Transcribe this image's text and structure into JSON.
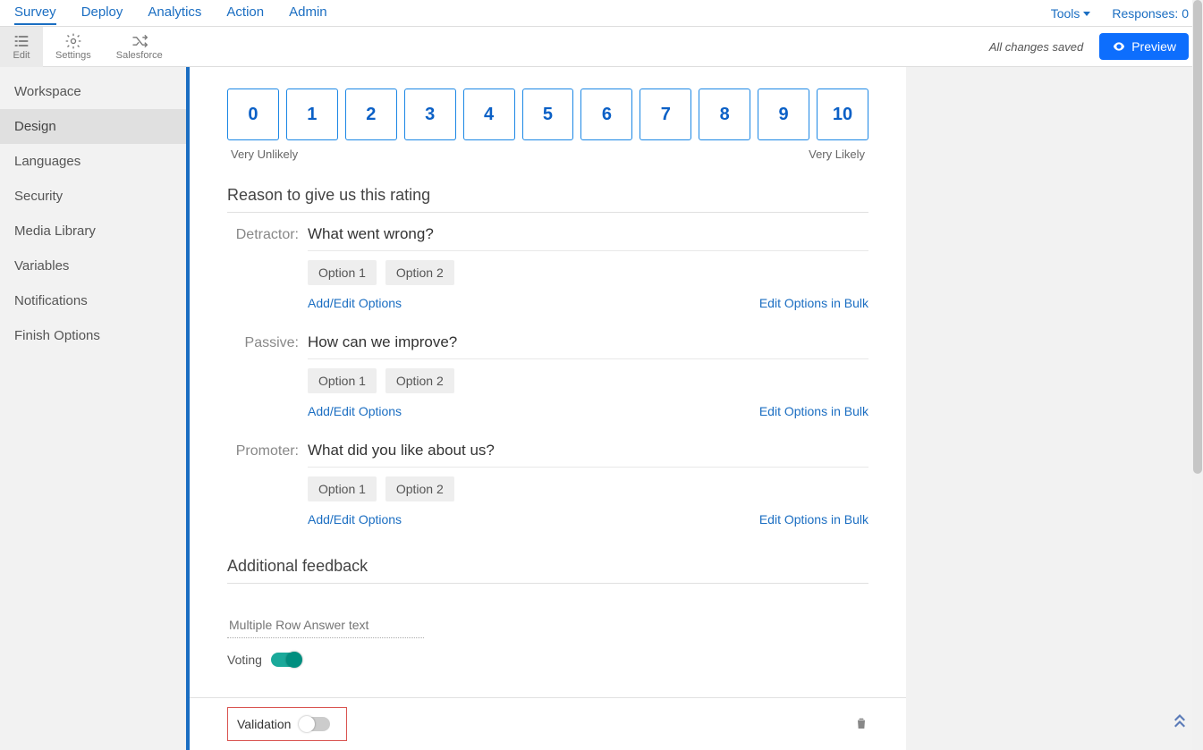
{
  "topnav": {
    "items": [
      "Survey",
      "Deploy",
      "Analytics",
      "Action",
      "Admin"
    ],
    "active_index": 0,
    "tools_label": "Tools",
    "responses_label": "Responses: 0"
  },
  "toolbar": {
    "items": [
      {
        "label": "Edit",
        "icon": "edit-list-icon"
      },
      {
        "label": "Settings",
        "icon": "gear-icon"
      },
      {
        "label": "Salesforce",
        "icon": "shuffle-icon"
      }
    ],
    "active_index": 0,
    "save_status": "All changes saved",
    "preview_label": "Preview"
  },
  "sidebar": {
    "items": [
      "Workspace",
      "Design",
      "Languages",
      "Security",
      "Media Library",
      "Variables",
      "Notifications",
      "Finish Options"
    ],
    "active_index": 1
  },
  "nps": {
    "values": [
      "0",
      "1",
      "2",
      "3",
      "4",
      "5",
      "6",
      "7",
      "8",
      "9",
      "10"
    ],
    "left_label": "Very Unlikely",
    "right_label": "Very Likely"
  },
  "reason_title": "Reason to give us this rating",
  "followups": [
    {
      "label": "Detractor:",
      "question": "What went wrong?",
      "options": [
        "Option 1",
        "Option 2"
      ],
      "add_label": "Add/Edit Options",
      "bulk_label": "Edit Options in Bulk"
    },
    {
      "label": "Passive:",
      "question": "How can we improve?",
      "options": [
        "Option 1",
        "Option 2"
      ],
      "add_label": "Add/Edit Options",
      "bulk_label": "Edit Options in Bulk"
    },
    {
      "label": "Promoter:",
      "question": "What did you like about us?",
      "options": [
        "Option 1",
        "Option 2"
      ],
      "add_label": "Add/Edit Options",
      "bulk_label": "Edit Options in Bulk"
    }
  ],
  "additional_feedback_title": "Additional feedback",
  "feedback_placeholder": "Multiple Row Answer text",
  "voting": {
    "label": "Voting",
    "on": true
  },
  "validation": {
    "label": "Validation",
    "on": false
  }
}
